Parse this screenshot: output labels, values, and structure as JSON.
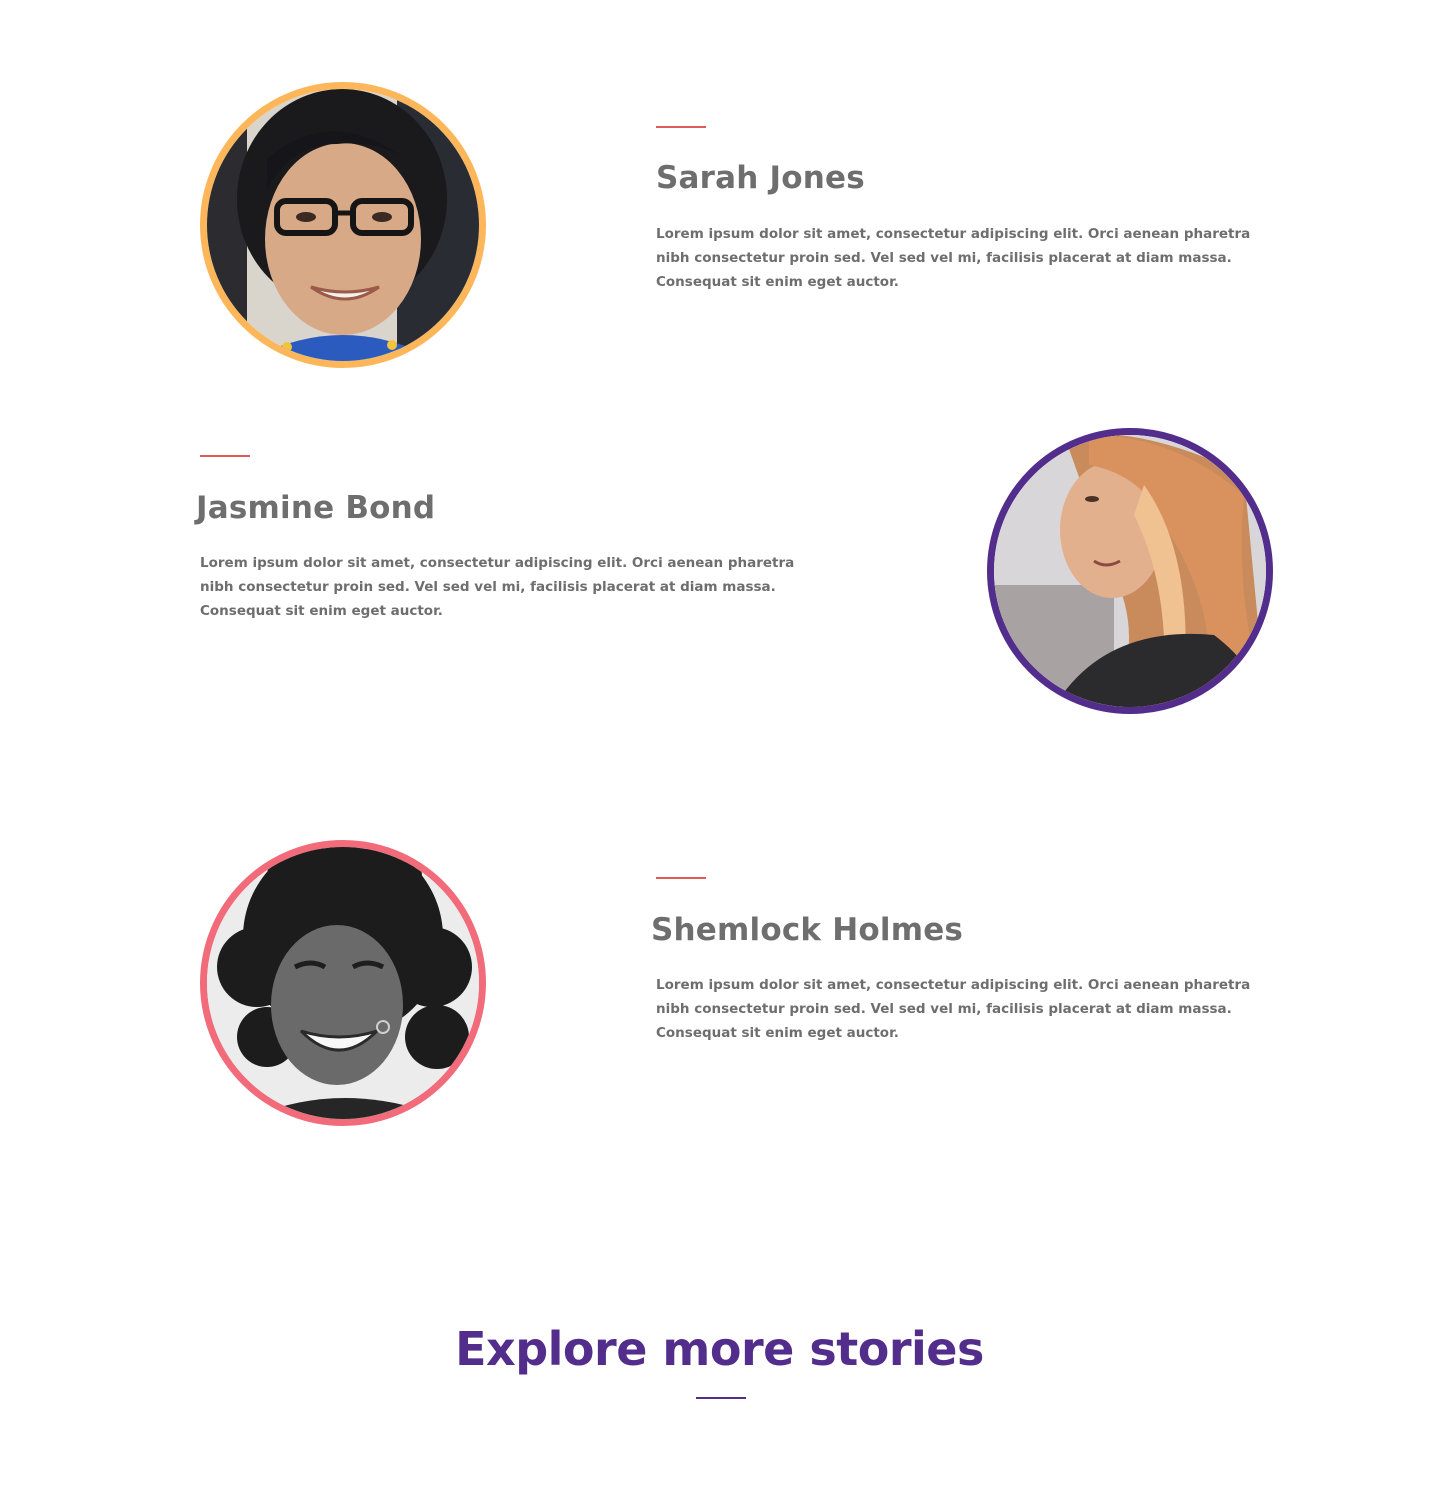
{
  "colors": {
    "accent_line": "#e05a5a",
    "heading_text": "#6e6e6e",
    "body_text": "#6e6e6e",
    "explore": "#522d8c",
    "ring_orange": "#fdb75a",
    "ring_purple": "#522d8c",
    "ring_pink": "#f26b7a"
  },
  "profiles": [
    {
      "name": "Sarah Jones",
      "bio": "Lorem ipsum dolor sit amet, consectetur adipiscing elit. Orci aenean pharetra nibh consectetur proin sed. Vel sed vel mi, facilisis placerat at diam massa. Consequat sit enim eget auctor.",
      "avatar_ring": "orange"
    },
    {
      "name": "Jasmine Bond",
      "bio": "Lorem ipsum dolor sit amet, consectetur adipiscing elit. Orci aenean pharetra nibh consectetur proin sed. Vel sed vel mi, facilisis placerat at diam massa. Consequat sit enim eget auctor.",
      "avatar_ring": "purple"
    },
    {
      "name": "Shemlock Holmes",
      "bio": "Lorem ipsum dolor sit amet, consectetur adipiscing elit. Orci aenean pharetra nibh consectetur proin sed. Vel sed vel mi, facilisis placerat at diam massa. Consequat sit enim eget auctor.",
      "avatar_ring": "pink"
    }
  ],
  "explore": {
    "title": "Explore more stories"
  }
}
